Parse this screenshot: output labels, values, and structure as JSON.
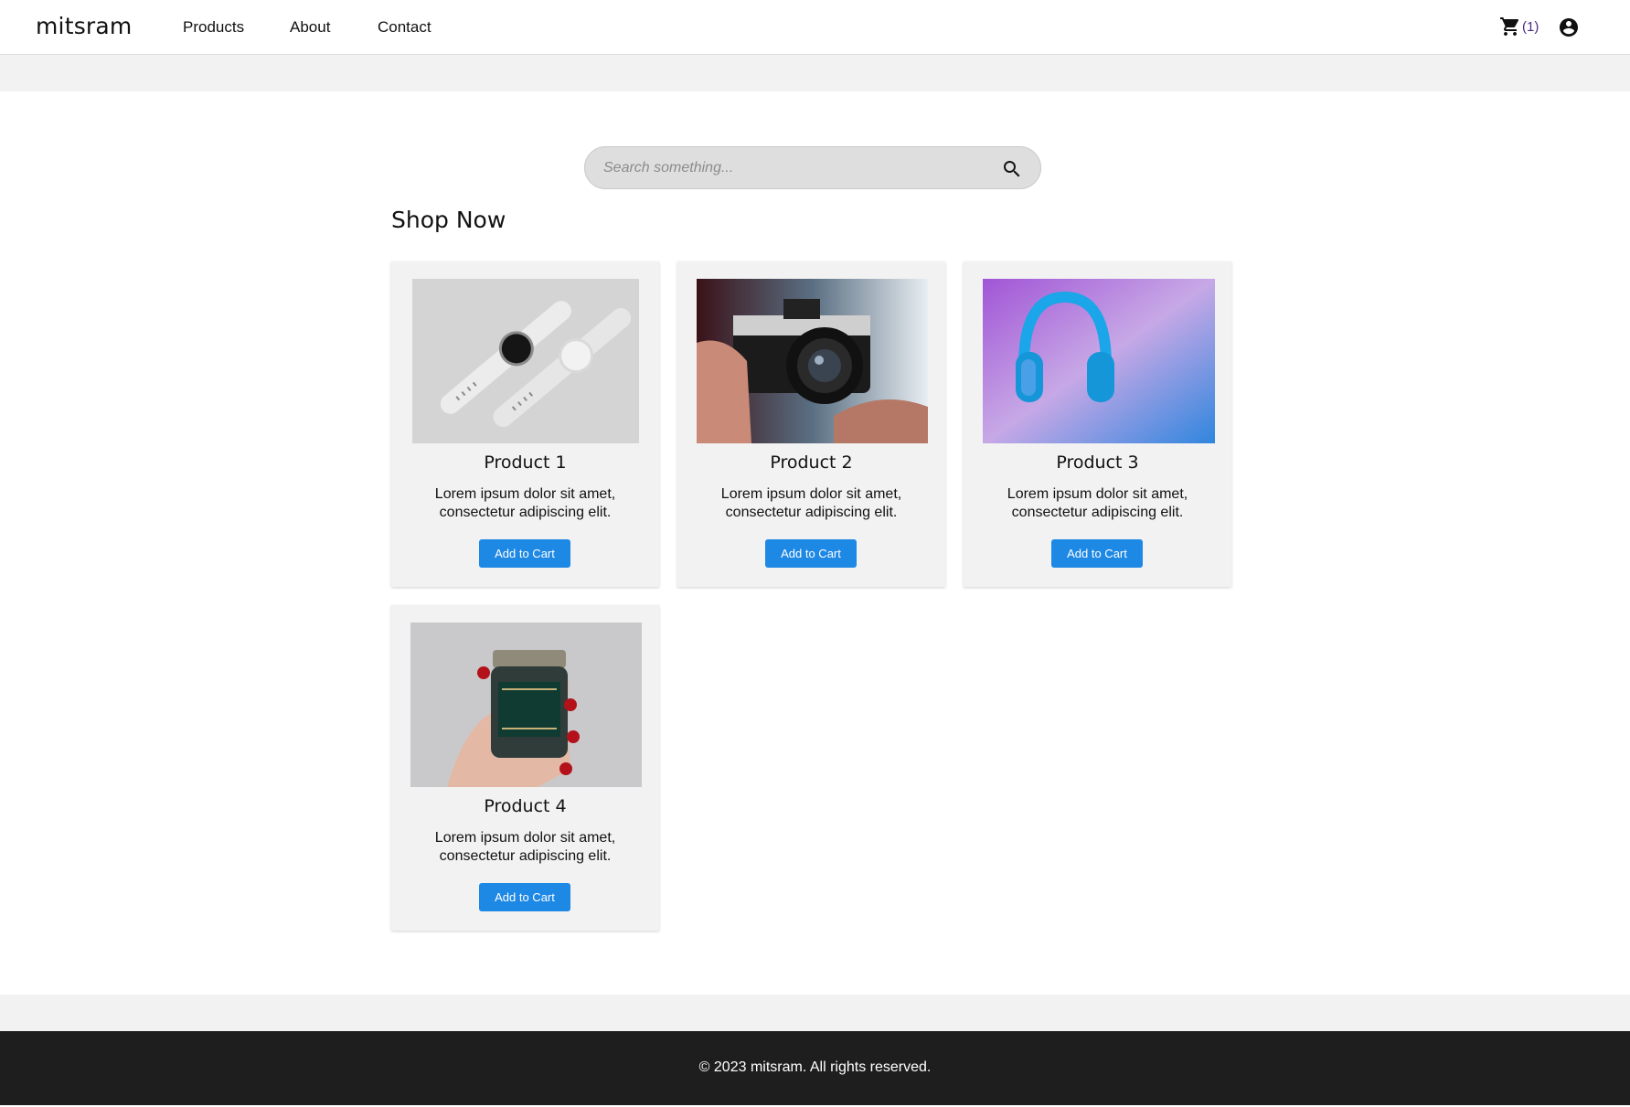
{
  "header": {
    "brand": "mitsram",
    "nav": [
      "Products",
      "About",
      "Contact"
    ],
    "cart_count": "(1)",
    "icons": [
      "shopping-cart-icon",
      "account-circle-icon"
    ]
  },
  "search": {
    "placeholder": "Search something..."
  },
  "section": {
    "title": "Shop Now"
  },
  "products": [
    {
      "name": "Product 1",
      "description": "Lorem ipsum dolor sit amet, consectetur adipiscing elit.",
      "button": "Add to Cart"
    },
    {
      "name": "Product 2",
      "description": "Lorem ipsum dolor sit amet, consectetur adipiscing elit.",
      "button": "Add to Cart"
    },
    {
      "name": "Product 3",
      "description": "Lorem ipsum dolor sit amet, consectetur adipiscing elit.",
      "button": "Add to Cart"
    },
    {
      "name": "Product 4",
      "description": "Lorem ipsum dolor sit amet, consectetur adipiscing elit.",
      "button": "Add to Cart"
    }
  ],
  "footer": {
    "text": "© 2023 mitsram. All rights reserved."
  },
  "colors": {
    "accent": "#1e88e5",
    "cart_count": "#4a2c84",
    "footer_bg": "#1e1e1e",
    "band_bg": "#f2f2f2"
  }
}
